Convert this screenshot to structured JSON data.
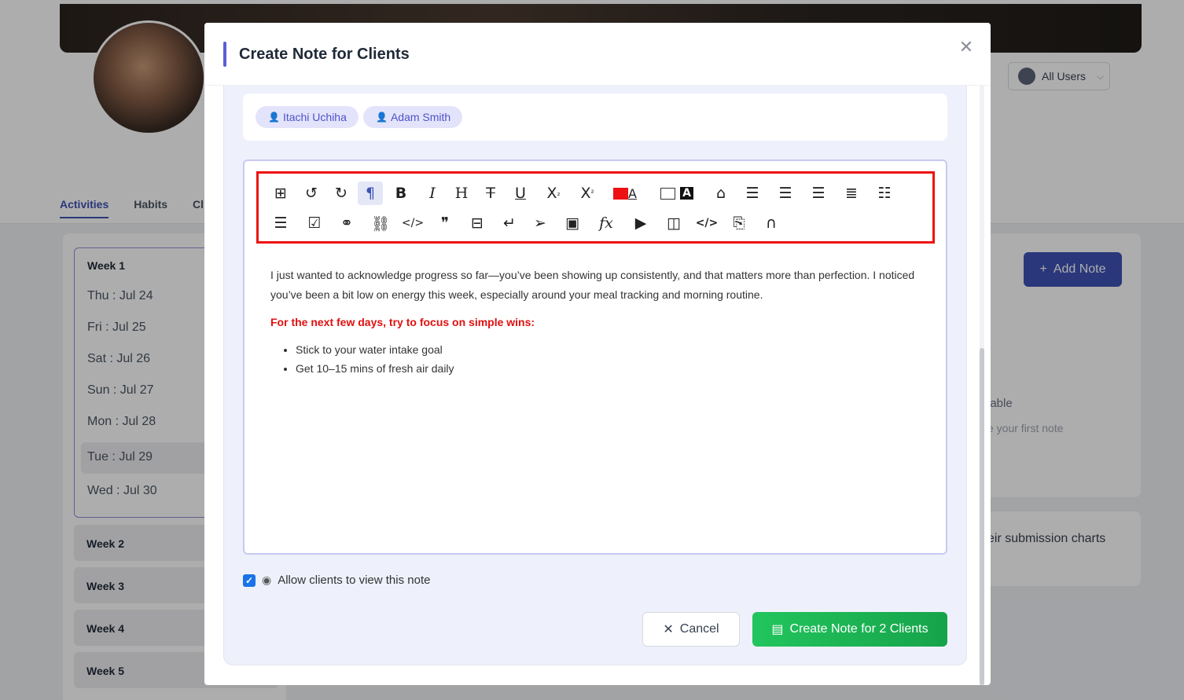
{
  "background": {
    "user_filter": {
      "label": "All Users"
    },
    "tabs": [
      {
        "label": "Activities"
      },
      {
        "label": "Habits"
      },
      {
        "label": "Cl"
      }
    ],
    "week1": {
      "title": "Week 1",
      "days": [
        {
          "label": "Thu : Jul 24"
        },
        {
          "label": "Fri : Jul 25"
        },
        {
          "label": "Sat : Jul 26"
        },
        {
          "label": "Sun : Jul 27"
        },
        {
          "label": "Mon : Jul 28"
        },
        {
          "label": "Tue : Jul 29"
        },
        {
          "label": "Wed : Jul 30"
        }
      ]
    },
    "weeks": [
      {
        "label": "Week 2"
      },
      {
        "label": "Week 3"
      },
      {
        "label": "Week 4"
      },
      {
        "label": "Week 5"
      }
    ],
    "add_note_label": "Add Note",
    "right_text_1": "lable",
    "right_text_2": "e your first note",
    "right_text_3": "eir submission charts"
  },
  "modal": {
    "title": "Create Note for Clients",
    "recipients": [
      {
        "name": "Itachi Uchiha"
      },
      {
        "name": "Adam Smith"
      }
    ],
    "toolbar": {
      "row1": [
        {
          "icon": "table-icon",
          "glyph": "⊞"
        },
        {
          "icon": "undo-icon",
          "glyph": "↺"
        },
        {
          "icon": "redo-icon",
          "glyph": "↻"
        },
        {
          "icon": "paragraph-icon",
          "glyph": "¶"
        },
        {
          "icon": "bold-icon",
          "glyph": "B"
        },
        {
          "icon": "italic-icon",
          "glyph": "I"
        },
        {
          "icon": "heading-icon",
          "glyph": "H"
        },
        {
          "icon": "strikethrough-icon",
          "glyph": "T̶"
        },
        {
          "icon": "underline-icon",
          "glyph": "U̲"
        },
        {
          "icon": "subscript-icon",
          "glyph": "X₂"
        },
        {
          "icon": "superscript-icon",
          "glyph": "X²"
        },
        {
          "icon": "font-color-icon",
          "glyph": "A"
        },
        {
          "icon": "highlight-color-icon",
          "glyph": "A"
        },
        {
          "icon": "clear-format-icon",
          "glyph": "⌫"
        },
        {
          "icon": "align-left-icon",
          "glyph": "☰"
        },
        {
          "icon": "align-center-icon",
          "glyph": "☰"
        },
        {
          "icon": "align-right-icon",
          "glyph": "☰"
        },
        {
          "icon": "align-justify-icon",
          "glyph": "☰"
        },
        {
          "icon": "bullet-list-icon",
          "glyph": "⁝☰"
        }
      ],
      "row2": [
        {
          "icon": "numbered-list-icon",
          "glyph": "⒈☰"
        },
        {
          "icon": "checklist-icon",
          "glyph": "☑"
        },
        {
          "icon": "link-icon",
          "glyph": "🔗"
        },
        {
          "icon": "unlink-icon",
          "glyph": "⛓"
        },
        {
          "icon": "inline-code-icon",
          "glyph": "</>"
        },
        {
          "icon": "blockquote-icon",
          "glyph": "❞"
        },
        {
          "icon": "horizontal-rule-icon",
          "glyph": "⊟"
        },
        {
          "icon": "line-break-icon",
          "glyph": "↵"
        },
        {
          "icon": "send-icon",
          "glyph": "➤"
        },
        {
          "icon": "image-icon",
          "glyph": "🖼"
        },
        {
          "icon": "formula-icon",
          "glyph": "fx"
        },
        {
          "icon": "youtube-icon",
          "glyph": "▶"
        },
        {
          "icon": "video-icon",
          "glyph": "▭"
        },
        {
          "icon": "code-block-icon",
          "glyph": "</>"
        },
        {
          "icon": "embed-file-icon",
          "glyph": "🗎"
        },
        {
          "icon": "audio-icon",
          "glyph": "🎧"
        }
      ],
      "font_color": "#ee1111",
      "highlight_color": "#ffffff"
    },
    "content": {
      "paragraph": "I just wanted to acknowledge progress so far—you’ve been showing up consistently, and that matters more than perfection. I noticed you’ve been a bit low on energy this week, especially around your meal tracking and morning routine.",
      "focus_heading": "For the next few days, try to focus on simple wins:",
      "bullets": [
        "Stick to your water intake goal",
        "Get 10–15 mins of fresh air daily"
      ]
    },
    "allow_view": {
      "label": "Allow clients to view this note",
      "checked": true
    },
    "cancel_label": "Cancel",
    "create_label": "Create Note for 2 Clients",
    "accent_color": "#5b5fd8",
    "create_color": "#22c55e"
  }
}
